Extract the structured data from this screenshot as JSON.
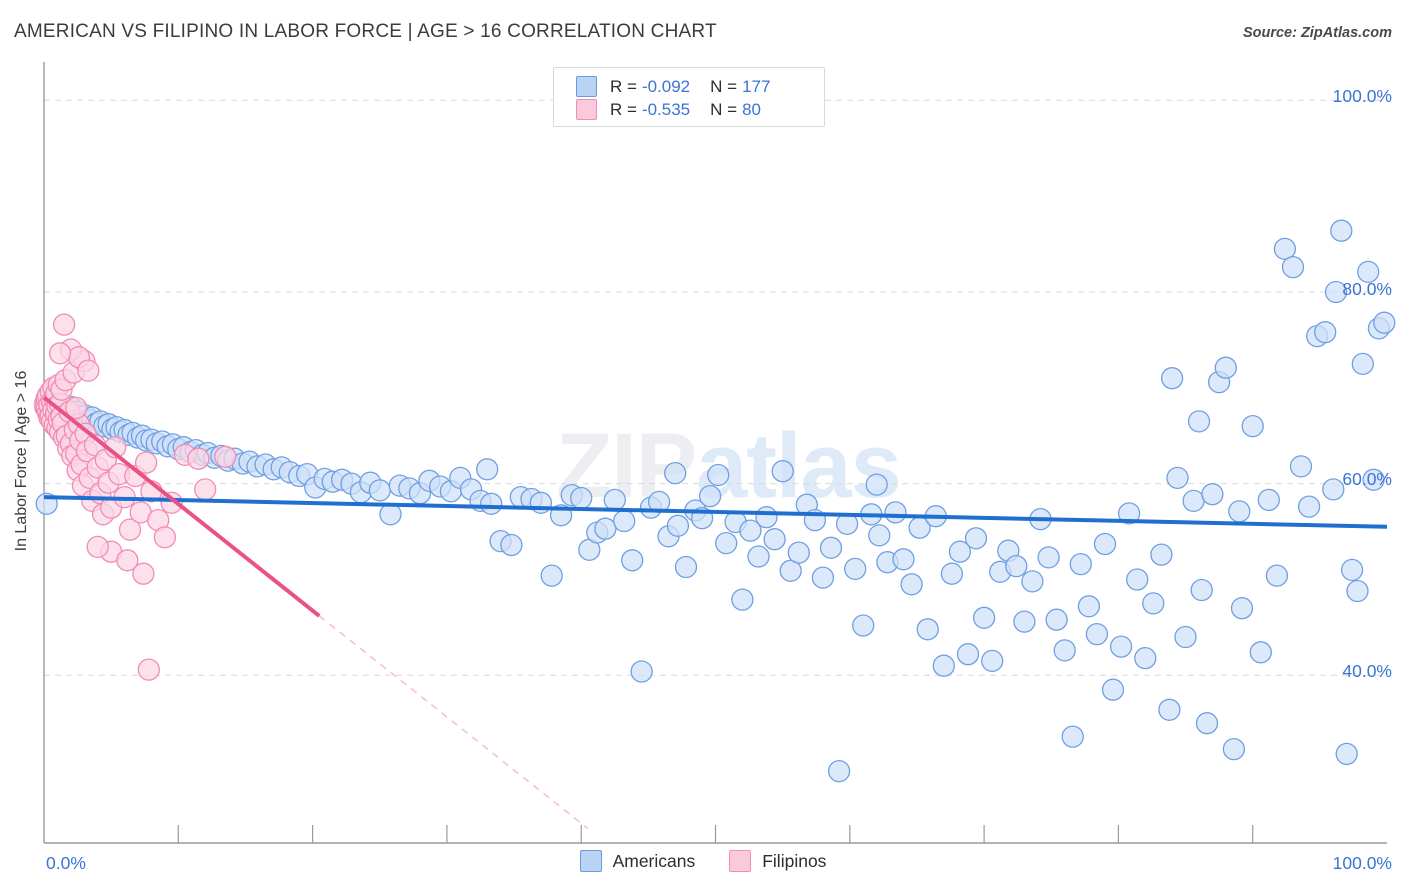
{
  "header": {
    "title": "AMERICAN VS FILIPINO IN LABOR FORCE | AGE > 16 CORRELATION CHART",
    "source": "Source: ZipAtlas.com"
  },
  "watermark": {
    "part1": "ZIP",
    "part2": "atlas"
  },
  "stats": {
    "rows": [
      {
        "r_label": "R =",
        "r_value": "-0.092",
        "n_label": "N =",
        "n_value": "177",
        "color": "#b9d3f5"
      },
      {
        "r_label": "R =",
        "r_value": "-0.535",
        "n_label": "N =",
        "n_value": "80",
        "color": "#fac9dc"
      }
    ]
  },
  "legend": {
    "items": [
      {
        "label": "Americans",
        "color": "#b9d3f5"
      },
      {
        "label": "Filipinos",
        "color": "#fac9dc"
      }
    ]
  },
  "axes": {
    "ylabel": "In Labor Force | Age > 16",
    "ytick_100": "100.0%",
    "ytick_80": "80.0%",
    "ytick_60": "60.0%",
    "ytick_40": "40.0%",
    "xtick_0": "0.0%",
    "xtick_100": "100.0%"
  },
  "colors": {
    "americans_fill": "#cfe1f8",
    "americans_stroke": "#6f9fe2",
    "filipinos_fill": "#fbd6e4",
    "filipinos_stroke": "#f28bb2",
    "trend_blue": "#1f6fd0",
    "trend_pink": "#ea5286",
    "grid": "#d9d9dd",
    "axis": "#9a9a9e",
    "tick_text": "#3a74d6"
  },
  "chart_data": {
    "type": "scatter",
    "title": "AMERICAN VS FILIPINO IN LABOR FORCE | AGE > 16 CORRELATION CHART",
    "xlabel": "",
    "ylabel": "In Labor Force | Age > 16",
    "xlim": [
      0,
      100
    ],
    "ylim": [
      22.5,
      104
    ],
    "xticks": [
      0,
      100
    ],
    "yticks": [
      40,
      60,
      80,
      100
    ],
    "ytick_labels": [
      "40.0%",
      "60.0%",
      "80.0%",
      "100.0%"
    ],
    "grid": "horizontal-dashed",
    "legend_position": "bottom-center",
    "series": [
      {
        "name": "Americans",
        "r": -0.092,
        "n": 177,
        "fill": "#cfe1f8",
        "stroke": "#6f9fe2",
        "trendline": {
          "x0": 0,
          "y0": 58.6,
          "x1": 100,
          "y1": 55.5,
          "color": "#1f6fd0"
        },
        "points": [
          [
            0.2,
            57.9
          ],
          [
            0.5,
            68.1
          ],
          [
            0.8,
            68.6
          ],
          [
            1.1,
            67.9
          ],
          [
            1.4,
            68.3
          ],
          [
            1.7,
            67.6
          ],
          [
            2.0,
            68.0
          ],
          [
            2.2,
            67.2
          ],
          [
            2.5,
            67.5
          ],
          [
            2.8,
            66.9
          ],
          [
            3.1,
            67.1
          ],
          [
            3.4,
            66.6
          ],
          [
            3.6,
            66.9
          ],
          [
            3.9,
            66.3
          ],
          [
            4.2,
            66.5
          ],
          [
            4.5,
            66.0
          ],
          [
            4.8,
            66.2
          ],
          [
            5.1,
            65.7
          ],
          [
            5.4,
            65.9
          ],
          [
            5.7,
            65.4
          ],
          [
            6.0,
            65.6
          ],
          [
            6.3,
            65.1
          ],
          [
            6.6,
            65.3
          ],
          [
            7.0,
            64.8
          ],
          [
            7.3,
            65.0
          ],
          [
            7.6,
            64.5
          ],
          [
            8.0,
            64.6
          ],
          [
            8.4,
            64.2
          ],
          [
            8.8,
            64.4
          ],
          [
            9.2,
            63.9
          ],
          [
            9.6,
            64.1
          ],
          [
            10.0,
            63.6
          ],
          [
            10.4,
            63.8
          ],
          [
            10.9,
            63.3
          ],
          [
            11.3,
            63.5
          ],
          [
            11.8,
            63.0
          ],
          [
            12.2,
            63.2
          ],
          [
            12.7,
            62.7
          ],
          [
            13.2,
            62.9
          ],
          [
            13.7,
            62.4
          ],
          [
            14.2,
            62.6
          ],
          [
            14.8,
            62.1
          ],
          [
            15.3,
            62.3
          ],
          [
            15.9,
            61.8
          ],
          [
            16.5,
            62.0
          ],
          [
            17.1,
            61.5
          ],
          [
            17.7,
            61.7
          ],
          [
            18.3,
            61.2
          ],
          [
            19.0,
            60.8
          ],
          [
            19.6,
            61.0
          ],
          [
            20.2,
            59.6
          ],
          [
            20.9,
            60.5
          ],
          [
            21.5,
            60.2
          ],
          [
            22.2,
            60.4
          ],
          [
            22.9,
            60.0
          ],
          [
            23.6,
            59.1
          ],
          [
            24.3,
            60.1
          ],
          [
            25.0,
            59.3
          ],
          [
            25.8,
            56.8
          ],
          [
            26.5,
            59.8
          ],
          [
            27.2,
            59.5
          ],
          [
            28.0,
            59.0
          ],
          [
            28.7,
            60.3
          ],
          [
            29.5,
            59.7
          ],
          [
            30.3,
            59.2
          ],
          [
            31.0,
            60.6
          ],
          [
            31.8,
            59.4
          ],
          [
            32.5,
            58.2
          ],
          [
            33.3,
            57.9
          ],
          [
            34.0,
            54.0
          ],
          [
            34.8,
            53.6
          ],
          [
            35.5,
            58.6
          ],
          [
            36.3,
            58.4
          ],
          [
            37.0,
            58.0
          ],
          [
            37.8,
            50.4
          ],
          [
            38.5,
            56.7
          ],
          [
            39.3,
            58.8
          ],
          [
            40.0,
            58.5
          ],
          [
            40.6,
            53.1
          ],
          [
            41.2,
            54.9
          ],
          [
            41.8,
            55.3
          ],
          [
            42.5,
            58.3
          ],
          [
            43.2,
            56.1
          ],
          [
            43.8,
            52.0
          ],
          [
            44.5,
            40.4
          ],
          [
            45.2,
            57.5
          ],
          [
            45.8,
            58.1
          ],
          [
            46.5,
            54.5
          ],
          [
            47.2,
            55.6
          ],
          [
            47.8,
            51.3
          ],
          [
            48.5,
            57.2
          ],
          [
            49.0,
            56.4
          ],
          [
            49.6,
            58.7
          ],
          [
            50.2,
            60.9
          ],
          [
            50.8,
            53.8
          ],
          [
            51.5,
            56.0
          ],
          [
            52.0,
            47.9
          ],
          [
            52.6,
            55.1
          ],
          [
            53.2,
            52.4
          ],
          [
            53.8,
            56.5
          ],
          [
            54.4,
            54.2
          ],
          [
            55.0,
            61.3
          ],
          [
            55.6,
            50.9
          ],
          [
            56.2,
            52.8
          ],
          [
            56.8,
            57.8
          ],
          [
            57.4,
            56.2
          ],
          [
            58.0,
            50.2
          ],
          [
            58.6,
            53.3
          ],
          [
            59.2,
            30.0
          ],
          [
            59.8,
            55.8
          ],
          [
            60.4,
            51.1
          ],
          [
            61.0,
            45.2
          ],
          [
            61.6,
            56.8
          ],
          [
            62.2,
            54.6
          ],
          [
            62.8,
            51.8
          ],
          [
            63.4,
            57.0
          ],
          [
            64.0,
            52.1
          ],
          [
            64.6,
            49.5
          ],
          [
            65.2,
            55.4
          ],
          [
            65.8,
            44.8
          ],
          [
            66.4,
            56.6
          ],
          [
            67.0,
            41.0
          ],
          [
            67.6,
            50.6
          ],
          [
            68.2,
            52.9
          ],
          [
            68.8,
            42.2
          ],
          [
            69.4,
            54.3
          ],
          [
            70.0,
            46.0
          ],
          [
            70.6,
            41.5
          ],
          [
            71.2,
            50.8
          ],
          [
            71.8,
            53.0
          ],
          [
            72.4,
            51.4
          ],
          [
            73.0,
            45.6
          ],
          [
            73.6,
            49.8
          ],
          [
            74.2,
            56.3
          ],
          [
            74.8,
            52.3
          ],
          [
            75.4,
            45.8
          ],
          [
            76.0,
            42.6
          ],
          [
            76.6,
            33.6
          ],
          [
            77.2,
            51.6
          ],
          [
            77.8,
            47.2
          ],
          [
            78.4,
            44.3
          ],
          [
            79.0,
            53.7
          ],
          [
            79.6,
            38.5
          ],
          [
            80.2,
            43.0
          ],
          [
            80.8,
            56.9
          ],
          [
            81.4,
            50.0
          ],
          [
            82.0,
            41.8
          ],
          [
            82.6,
            47.5
          ],
          [
            83.2,
            52.6
          ],
          [
            83.8,
            36.4
          ],
          [
            84.4,
            60.6
          ],
          [
            85.0,
            44.0
          ],
          [
            85.6,
            58.2
          ],
          [
            86.2,
            48.9
          ],
          [
            86.6,
            35.0
          ],
          [
            87.0,
            58.9
          ],
          [
            87.5,
            70.6
          ],
          [
            88.0,
            72.1
          ],
          [
            88.6,
            32.3
          ],
          [
            89.2,
            47.0
          ],
          [
            90.0,
            66.0
          ],
          [
            90.6,
            42.4
          ],
          [
            91.2,
            58.3
          ],
          [
            91.8,
            50.4
          ],
          [
            92.4,
            84.5
          ],
          [
            93.0,
            82.6
          ],
          [
            93.6,
            61.8
          ],
          [
            94.2,
            57.6
          ],
          [
            94.8,
            75.4
          ],
          [
            95.4,
            75.8
          ],
          [
            96.0,
            59.4
          ],
          [
            96.2,
            80.0
          ],
          [
            96.6,
            86.4
          ],
          [
            97.0,
            31.8
          ],
          [
            97.4,
            51.0
          ],
          [
            97.8,
            48.8
          ],
          [
            98.2,
            72.5
          ],
          [
            98.6,
            82.1
          ],
          [
            99.0,
            60.4
          ],
          [
            99.4,
            76.2
          ],
          [
            99.8,
            76.8
          ],
          [
            33.0,
            61.5
          ],
          [
            47.0,
            61.1
          ],
          [
            62.0,
            59.9
          ],
          [
            84.0,
            71.0
          ],
          [
            86.0,
            66.5
          ],
          [
            89.0,
            57.1
          ]
        ]
      },
      {
        "name": "Filipinos",
        "r": -0.535,
        "n": 80,
        "fill": "#fbd6e4",
        "stroke": "#f28bb2",
        "trendline": {
          "x0": 0,
          "y0": 69.0,
          "x1": 20.5,
          "y1": 46.2,
          "color": "#ea5286"
        },
        "trendline_dashed": {
          "x0": 20.5,
          "y0": 46.2,
          "x1": 40.5,
          "y1": 24.0,
          "color": "#f5c0d2"
        },
        "points": [
          [
            0.1,
            68.4
          ],
          [
            0.1,
            68.0
          ],
          [
            0.2,
            67.8
          ],
          [
            0.2,
            68.9
          ],
          [
            0.3,
            69.2
          ],
          [
            0.3,
            67.4
          ],
          [
            0.4,
            68.2
          ],
          [
            0.4,
            66.9
          ],
          [
            0.5,
            69.6
          ],
          [
            0.5,
            67.1
          ],
          [
            0.6,
            68.6
          ],
          [
            0.6,
            66.5
          ],
          [
            0.7,
            70.0
          ],
          [
            0.7,
            67.7
          ],
          [
            0.8,
            68.8
          ],
          [
            0.8,
            66.1
          ],
          [
            0.9,
            69.4
          ],
          [
            0.9,
            67.3
          ],
          [
            1.0,
            68.1
          ],
          [
            1.0,
            65.8
          ],
          [
            1.1,
            70.3
          ],
          [
            1.1,
            66.7
          ],
          [
            1.2,
            68.3
          ],
          [
            1.2,
            65.4
          ],
          [
            1.3,
            69.8
          ],
          [
            1.3,
            67.0
          ],
          [
            1.4,
            66.3
          ],
          [
            1.5,
            64.8
          ],
          [
            1.6,
            70.8
          ],
          [
            1.7,
            65.0
          ],
          [
            1.8,
            63.7
          ],
          [
            1.9,
            67.5
          ],
          [
            2.0,
            64.2
          ],
          [
            2.1,
            62.9
          ],
          [
            2.2,
            71.6
          ],
          [
            2.3,
            65.6
          ],
          [
            2.4,
            63.1
          ],
          [
            2.5,
            61.4
          ],
          [
            2.6,
            66.2
          ],
          [
            2.7,
            64.5
          ],
          [
            2.8,
            62.0
          ],
          [
            2.9,
            59.8
          ],
          [
            3.0,
            72.8
          ],
          [
            3.1,
            65.2
          ],
          [
            3.2,
            63.4
          ],
          [
            3.4,
            60.6
          ],
          [
            3.6,
            58.2
          ],
          [
            3.8,
            64.0
          ],
          [
            4.0,
            61.7
          ],
          [
            4.2,
            59.0
          ],
          [
            4.4,
            56.8
          ],
          [
            4.6,
            62.5
          ],
          [
            4.8,
            60.1
          ],
          [
            5.0,
            57.5
          ],
          [
            5.3,
            63.8
          ],
          [
            5.6,
            61.0
          ],
          [
            6.0,
            58.6
          ],
          [
            6.4,
            55.2
          ],
          [
            6.8,
            60.8
          ],
          [
            7.2,
            57.0
          ],
          [
            7.6,
            62.2
          ],
          [
            8.0,
            59.2
          ],
          [
            8.5,
            56.2
          ],
          [
            9.0,
            54.4
          ],
          [
            1.5,
            76.6
          ],
          [
            2.0,
            74.0
          ],
          [
            2.6,
            73.2
          ],
          [
            3.3,
            71.8
          ],
          [
            1.2,
            73.6
          ],
          [
            2.4,
            67.9
          ],
          [
            5.0,
            52.9
          ],
          [
            7.4,
            50.6
          ],
          [
            4.0,
            53.4
          ],
          [
            7.8,
            40.6
          ],
          [
            10.5,
            63.0
          ],
          [
            11.5,
            62.6
          ],
          [
            12.0,
            59.4
          ],
          [
            13.5,
            62.8
          ],
          [
            6.2,
            52.0
          ],
          [
            9.5,
            58.0
          ]
        ]
      }
    ]
  }
}
